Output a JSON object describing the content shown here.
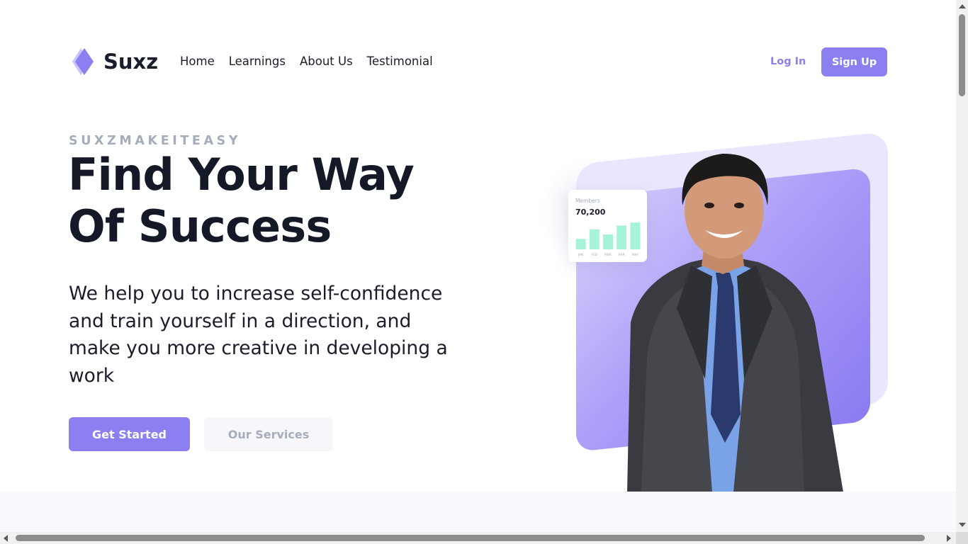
{
  "brand": {
    "name": "Suxz",
    "logo_icon": "diamond-logo-icon",
    "accent_color": "#8b7ff2"
  },
  "nav": {
    "links": [
      "Home",
      "Learnings",
      "About Us",
      "Testimonial"
    ],
    "login_label": "Log In",
    "signup_label": "Sign Up"
  },
  "hero": {
    "eyebrow": "SUXZMAKEITEASY",
    "headline_line1": "Find Your Way",
    "headline_line2": "Of Success",
    "description": "We help you to increase self-confidence and train yourself in a direction, and make you more creative in developing a work",
    "primary_cta": "Get Started",
    "secondary_cta": "Our Services"
  },
  "stat_card": {
    "label": "Members",
    "value": "70,200",
    "chart_data": {
      "type": "bar",
      "categories": [
        "JAN",
        "FEB",
        "MAR",
        "APR",
        "MAY"
      ],
      "values": [
        14,
        27,
        20,
        32,
        36
      ],
      "ylim": [
        0,
        40
      ],
      "bar_color": "#a6f3d8"
    }
  }
}
